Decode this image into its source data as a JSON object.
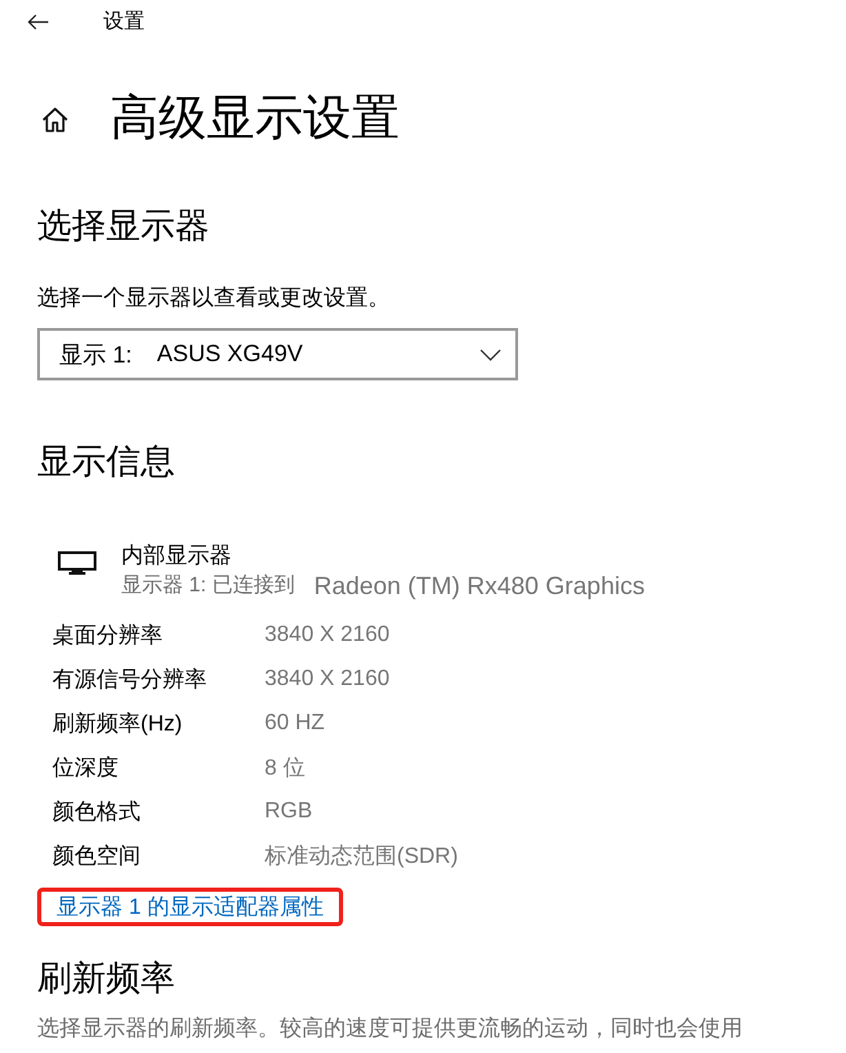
{
  "header": {
    "title": "设置"
  },
  "page_title": "高级显示设置",
  "select_display": {
    "heading": "选择显示器",
    "description": "选择一个显示器以查看或更改设置。",
    "dropdown": {
      "label": "显示 1:",
      "value": "ASUS XG49V"
    }
  },
  "display_info": {
    "heading": "显示信息",
    "monitor": {
      "name": "内部显示器",
      "connection": "显示器 1: 已连接到",
      "adapter": "Radeon (TM) Rx480 Graphics"
    },
    "rows": [
      {
        "label": "桌面分辨率",
        "value": "3840 X 2160"
      },
      {
        "label": "有源信号分辨率",
        "value": "3840 X 2160"
      },
      {
        "label": "刷新频率(Hz)",
        "value": "60 HZ"
      },
      {
        "label": "位深度",
        "value": "8 位"
      },
      {
        "label": "颜色格式",
        "value": "RGB"
      },
      {
        "label": "颜色空间",
        "value": "标准动态范围(SDR)"
      }
    ],
    "link": {
      "text": "显示器 1 的显示适配器属性",
      "highlighted": true
    }
  },
  "refresh_rate": {
    "heading": "刷新频率",
    "description": "选择显示器的刷新频率。较高的速度可提供更流畅的运动，同时也会使用"
  }
}
